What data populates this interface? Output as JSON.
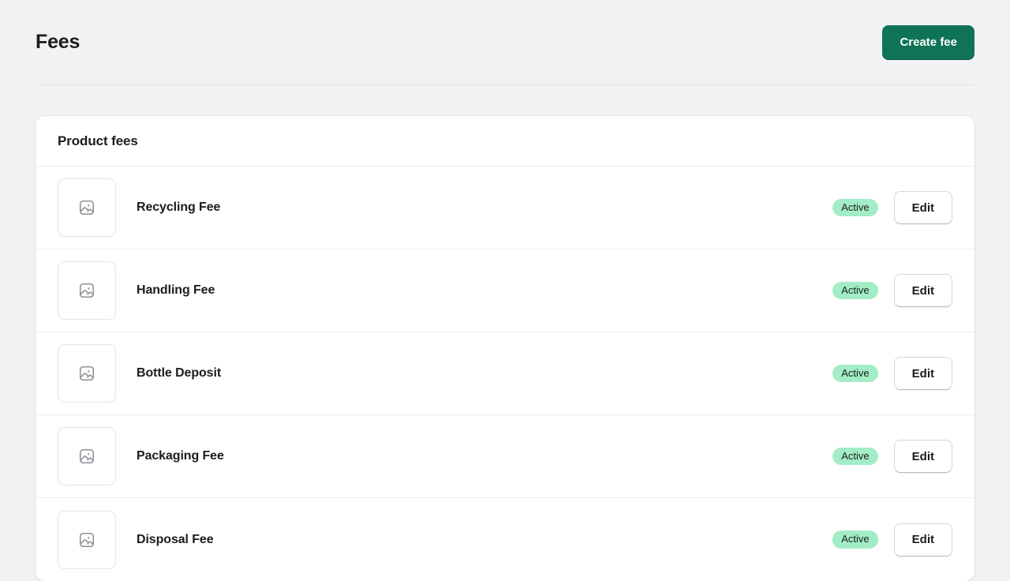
{
  "header": {
    "title": "Fees",
    "primary_action": "Create fee"
  },
  "card": {
    "title": "Product fees",
    "rows": [
      {
        "name": "Recycling Fee",
        "status": "Active",
        "action": "Edit",
        "thumbnail_icon": "image-placeholder-icon"
      },
      {
        "name": "Handling Fee",
        "status": "Active",
        "action": "Edit",
        "thumbnail_icon": "image-placeholder-icon"
      },
      {
        "name": "Bottle Deposit",
        "status": "Active",
        "action": "Edit",
        "thumbnail_icon": "image-placeholder-icon"
      },
      {
        "name": "Packaging Fee",
        "status": "Active",
        "action": "Edit",
        "thumbnail_icon": "image-placeholder-icon"
      },
      {
        "name": "Disposal Fee",
        "status": "Active",
        "action": "Edit",
        "thumbnail_icon": "image-placeholder-icon"
      }
    ]
  },
  "colors": {
    "page_background": "#f1f2f4",
    "primary_button": "#0f7355",
    "badge_background": "#a3edc6",
    "card_background": "#ffffff",
    "divider": "#ebecef",
    "text": "#1a1c1d"
  }
}
